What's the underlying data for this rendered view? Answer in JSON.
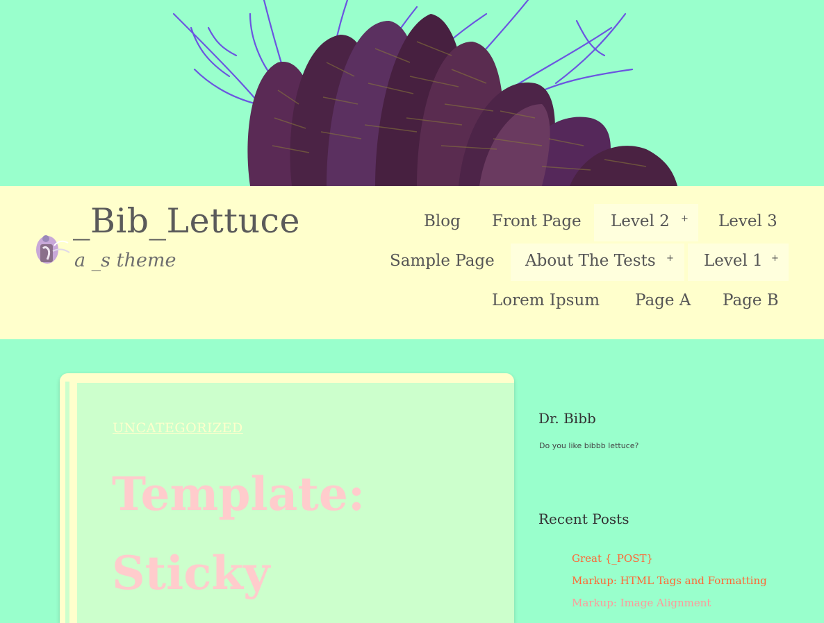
{
  "header": {
    "site_title": "_Bib_Lettuce",
    "site_description": "a _s theme"
  },
  "nav": {
    "items": [
      {
        "label": "Blog"
      },
      {
        "label": "Front Page"
      },
      {
        "label": "Level 2",
        "has_submenu": true
      },
      {
        "label": "Level 3"
      },
      {
        "label": "Sample Page"
      },
      {
        "label": "About The Tests",
        "has_submenu": true
      },
      {
        "label": "Level 1",
        "has_submenu": true
      },
      {
        "label": "Lorem Ipsum"
      },
      {
        "label": "Page A"
      },
      {
        "label": "Page B"
      }
    ],
    "submenu_indicator": "+"
  },
  "post": {
    "category": "UNCATEGORIZED",
    "title": "Template: Sticky"
  },
  "sidebar": {
    "about_widget": {
      "title": "Dr. Bibb",
      "text": "Do you like bibbb lettuce?"
    },
    "recent_posts": {
      "title": "Recent Posts",
      "items": [
        {
          "label": "Great {_POST}",
          "color": "#ff6633"
        },
        {
          "label": "Markup: HTML Tags and Formatting",
          "color": "#ff6633"
        },
        {
          "label": "Markup: Image Alignment",
          "color": "#ff9999"
        }
      ]
    }
  },
  "colors": {
    "background": "#99ffcc",
    "masthead": "#ffffcc",
    "card": "#ccffcc",
    "title_pink": "#ffcccc",
    "link_orange": "#ff6633"
  }
}
